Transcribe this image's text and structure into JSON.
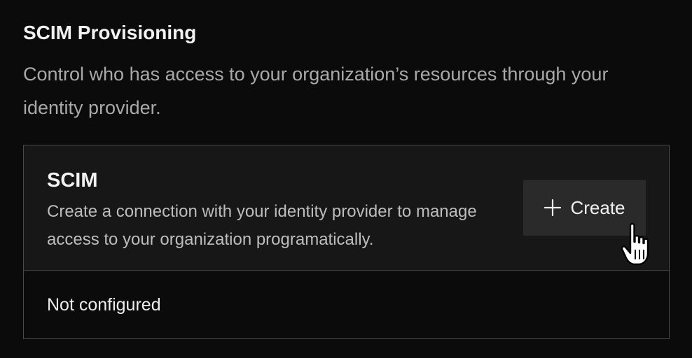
{
  "section": {
    "title": "SCIM Provisioning",
    "description": "Control who has access to your organization’s resources through your identity provider."
  },
  "card": {
    "title": "SCIM",
    "description": "Create a connection with your identity provider to manage access to your organization programatically.",
    "create_label": "Create",
    "status": "Not configured"
  },
  "icons": {
    "create": "plus-icon",
    "cursor": "hand-pointer-cursor-icon"
  }
}
